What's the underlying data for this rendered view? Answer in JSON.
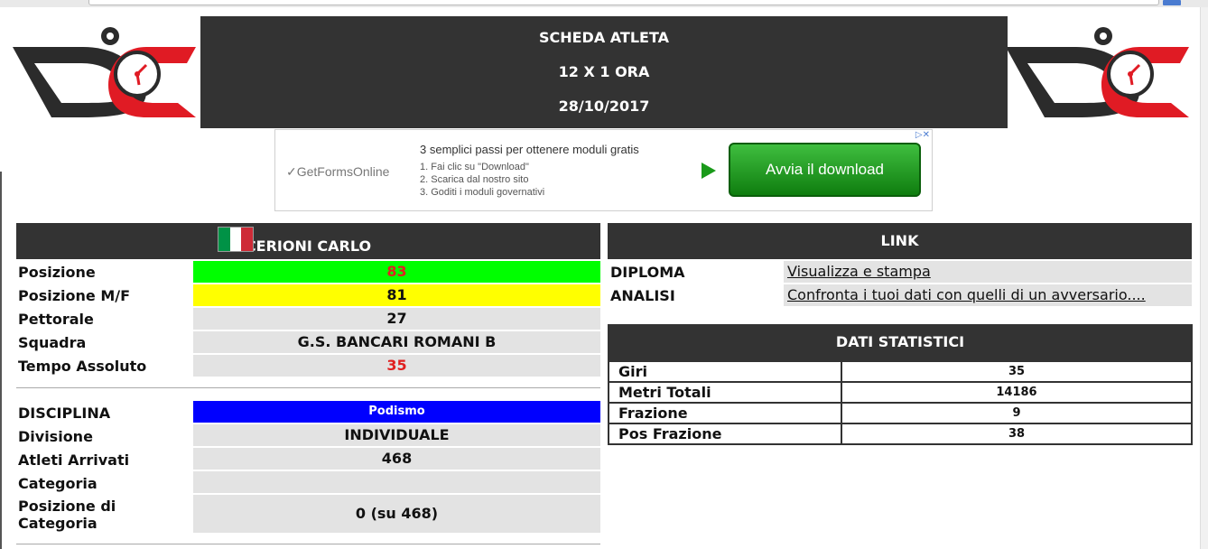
{
  "header": {
    "line1": "SCHEDA ATLETA",
    "line2": "12 X 1 ORA",
    "line3": "28/10/2017"
  },
  "ad": {
    "brand": "✓GetFormsOnline",
    "title": "3 semplici passi per ottenere moduli gratis",
    "step1": "1. Fai clic su \"Download\"",
    "step2": "2. Scarica dal nostro sito",
    "step3": "3. Goditi i moduli governativi",
    "button": "Avvia il download",
    "adchoices": "▷✕"
  },
  "athlete": {
    "name": "CERIONI CARLO",
    "flag_colors": [
      "#009246",
      "#ffffff",
      "#ce2b37"
    ],
    "rows": [
      {
        "label": "Posizione",
        "value": "83",
        "bg": "#00ff00",
        "color": "#e02020"
      },
      {
        "label": "Posizione M/F",
        "value": "81",
        "bg": "#ffff00",
        "color": "#111111"
      },
      {
        "label": "Pettorale",
        "value": "27",
        "bg": "#e3e3e3",
        "color": "#111111"
      },
      {
        "label": "Squadra",
        "value": "G.S. BANCARI ROMANI B",
        "bg": "#e3e3e3",
        "color": "#111111"
      },
      {
        "label": "Tempo Assoluto",
        "value": "35",
        "bg": "#e3e3e3",
        "color": "#e02020"
      }
    ],
    "discipline_label": "DISCIPLINA",
    "discipline_value": "Podismo",
    "discipline_color": "#0000ff",
    "rows2": [
      {
        "label": "Divisione",
        "value": "INDIVIDUALE"
      },
      {
        "label": "Atleti Arrivati",
        "value": "468"
      },
      {
        "label": "Categoria",
        "value": ""
      },
      {
        "label": "Posizione di Categoria",
        "value": "0 (su 468)"
      }
    ]
  },
  "links": {
    "title": "LINK",
    "items": [
      {
        "label": "DIPLOMA",
        "text": "Visualizza e stampa"
      },
      {
        "label": "ANALISI",
        "text": "Confronta i tuoi dati con quelli di un avversario...."
      }
    ]
  },
  "stats": {
    "title": "DATI STATISTICI",
    "rows": [
      {
        "label": "Giri",
        "value": "35"
      },
      {
        "label": "Metri Totali",
        "value": "14186"
      },
      {
        "label": "Frazione",
        "value": "9"
      },
      {
        "label": "Pos Frazione",
        "value": "38"
      }
    ]
  },
  "colors": {
    "brand_red": "#e01b24",
    "brand_dark": "#2b2b2b",
    "header_bg": "#333333"
  }
}
